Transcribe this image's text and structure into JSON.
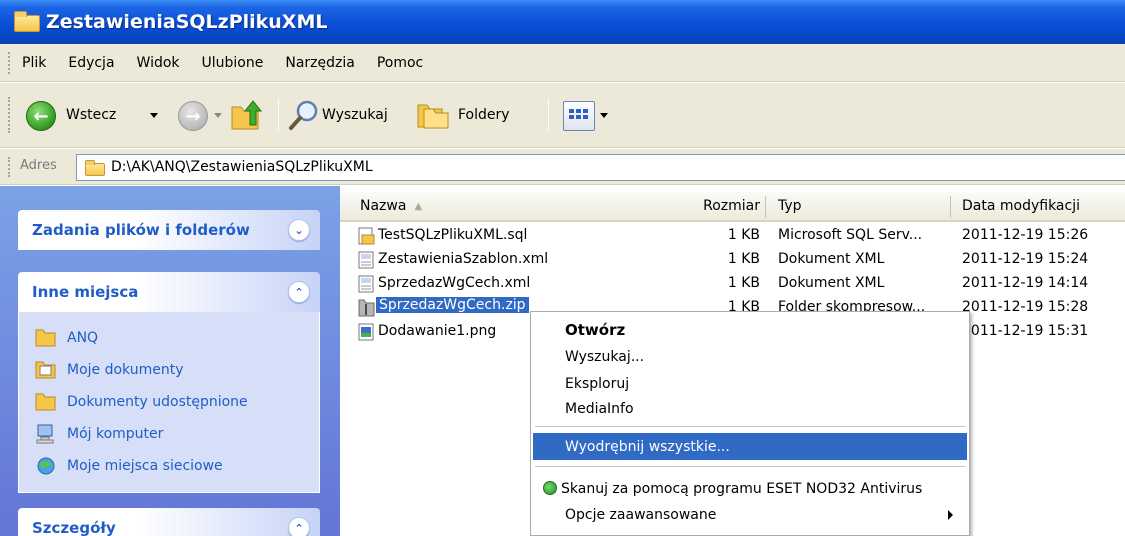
{
  "window": {
    "title": "ZestawieniaSQLzPlikuXML"
  },
  "menubar": {
    "items": [
      "Plik",
      "Edycja",
      "Widok",
      "Ulubione",
      "Narzędzia",
      "Pomoc"
    ]
  },
  "toolbar": {
    "back_label": "Wstecz",
    "search_label": "Wyszukaj",
    "folders_label": "Foldery",
    "icons": [
      "back-arrow-icon",
      "forward-arrow-icon",
      "folder-up-icon",
      "search-icon",
      "folders-icon",
      "views-icon"
    ]
  },
  "address": {
    "label": "Adres",
    "path": "D:\\AK\\ANQ\\ZestawieniaSQLzPlikuXML"
  },
  "taskpane": {
    "file_tasks_title": "Zadania plików i folderów",
    "other_places_title": "Inne miejsca",
    "other_places": [
      {
        "label": "ANQ",
        "icon": "folder-icon"
      },
      {
        "label": "Moje dokumenty",
        "icon": "my-documents-icon"
      },
      {
        "label": "Dokumenty udostępnione",
        "icon": "shared-folder-icon"
      },
      {
        "label": "Mój komputer",
        "icon": "my-computer-icon"
      },
      {
        "label": "Moje miejsca sieciowe",
        "icon": "network-places-icon"
      }
    ],
    "details_title": "Szczegóły"
  },
  "filelist": {
    "columns": {
      "name": "Nazwa",
      "size": "Rozmiar",
      "type": "Typ",
      "modified": "Data modyfikacji"
    },
    "rows": [
      {
        "name": "TestSQLzPlikuXML.sql",
        "size": "1 KB",
        "type": "Microsoft SQL Serv...",
        "modified": "2011-12-19 15:26",
        "icon": "sql-file-icon"
      },
      {
        "name": "ZestawieniaSzablon.xml",
        "size": "1 KB",
        "type": "Dokument XML",
        "modified": "2011-12-19 15:24",
        "icon": "xml-file-icon"
      },
      {
        "name": "SprzedazWgCech.xml",
        "size": "1 KB",
        "type": "Dokument XML",
        "modified": "2011-12-19 14:14",
        "icon": "xml-file-icon"
      },
      {
        "name": "SprzedazWgCech.zip",
        "size": "1 KB",
        "type": "Folder skompresow...",
        "modified": "2011-12-19 15:28",
        "icon": "zip-folder-icon",
        "selected": true
      },
      {
        "name": "Dodawanie1.png",
        "size": "",
        "type": "",
        "modified": "2011-12-19 15:31",
        "icon": "png-file-icon"
      }
    ]
  },
  "context_menu": {
    "items": [
      {
        "label": "Otwórz",
        "bold": true
      },
      {
        "label": "Wyszukaj..."
      },
      {
        "label": "Eksploruj"
      },
      {
        "label": "MediaInfo"
      },
      {
        "label": "Wyodrębnij wszystkie...",
        "highlighted": true
      },
      {
        "label": "Skanuj za pomocą programu ESET NOD32 Antivirus",
        "icon": "eset-icon"
      },
      {
        "label": "Opcje zaawansowane",
        "submenu": true
      }
    ]
  },
  "colors": {
    "titlebar": "#0a4fd6",
    "selection": "#316ac5",
    "taskpane_link": "#215dc6",
    "chrome": "#ece9d8"
  }
}
